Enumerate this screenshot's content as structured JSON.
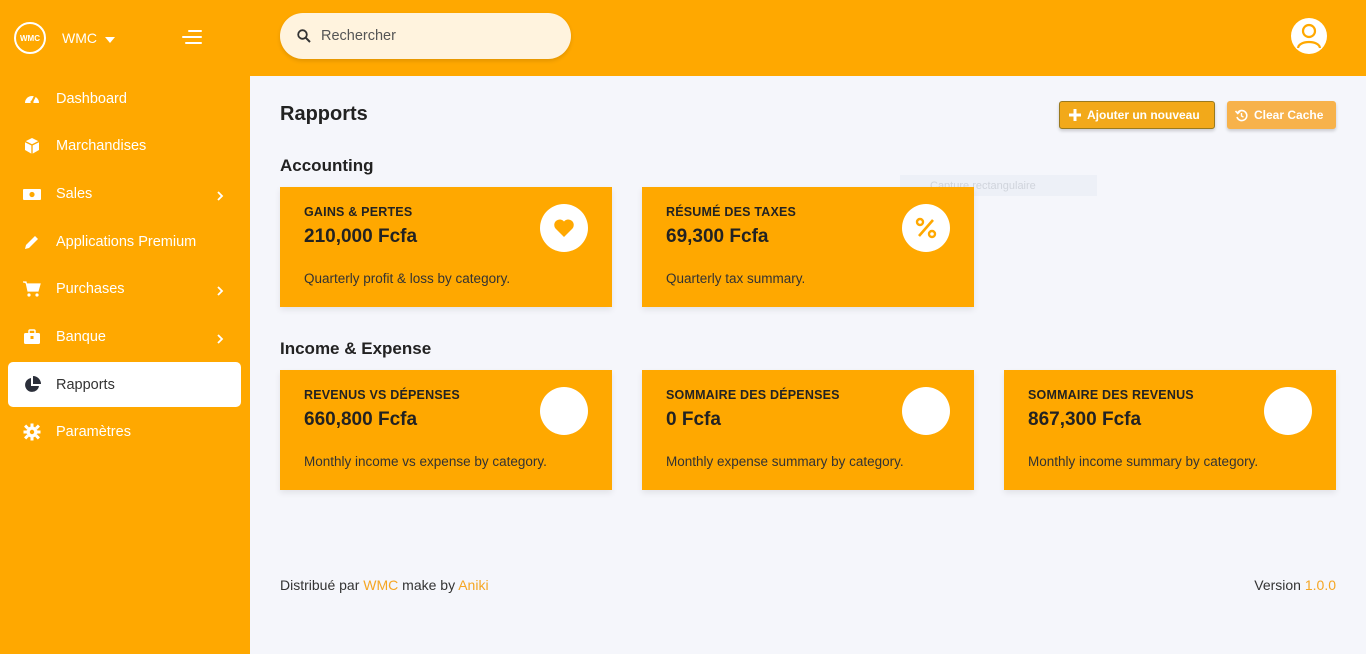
{
  "brand": {
    "logo_text": "WMC",
    "name": "WMC"
  },
  "sidebar": {
    "items": [
      {
        "label": "Dashboard",
        "icon": "speedometer-icon"
      },
      {
        "label": "Marchandises",
        "icon": "box-icon"
      },
      {
        "label": "Sales",
        "icon": "cash-icon",
        "has_submenu": true
      },
      {
        "label": "Applications Premium",
        "icon": "pencil-icon"
      },
      {
        "label": "Purchases",
        "icon": "cart-icon",
        "has_submenu": true
      },
      {
        "label": "Banque",
        "icon": "briefcase-icon",
        "has_submenu": true
      },
      {
        "label": "Rapports",
        "icon": "pie-chart-icon",
        "active": true
      },
      {
        "label": "Paramètres",
        "icon": "gear-icon"
      }
    ]
  },
  "search": {
    "placeholder": "Rechercher"
  },
  "page": {
    "title": "Rapports"
  },
  "actions": {
    "add_label": "Ajouter un nouveau",
    "clear_cache_label": "Clear Cache"
  },
  "ghost_text": "Capture rectangulaire",
  "sections": {
    "accounting": {
      "title": "Accounting",
      "cards": [
        {
          "title": "GAINS & PERTES",
          "value": "210,000 Fcfa",
          "desc": "Quarterly profit & loss by category.",
          "icon": "heart-icon"
        },
        {
          "title": "RÉSUMÉ DES TAXES",
          "value": "69,300 Fcfa",
          "desc": "Quarterly tax summary.",
          "icon": "percent-icon"
        }
      ]
    },
    "income_expense": {
      "title": "Income & Expense",
      "cards": [
        {
          "title": "REVENUS VS DÉPENSES",
          "value": "660,800 Fcfa",
          "desc": "Monthly income vs expense by category."
        },
        {
          "title": "SOMMAIRE DES DÉPENSES",
          "value": "0 Fcfa",
          "desc": "Monthly expense summary by category."
        },
        {
          "title": "SOMMAIRE DES REVENUS",
          "value": "867,300 Fcfa",
          "desc": "Monthly income summary by category."
        }
      ]
    }
  },
  "footer": {
    "prefix": "Distribué par",
    "brand": "WMC",
    "middle": "make by",
    "author": "Aniki"
  },
  "version": {
    "label": "Version",
    "number": "1.0.0"
  },
  "colors": {
    "primary": "#ffa800",
    "accent_text": "#f5a623",
    "background": "#f5f6fb"
  }
}
